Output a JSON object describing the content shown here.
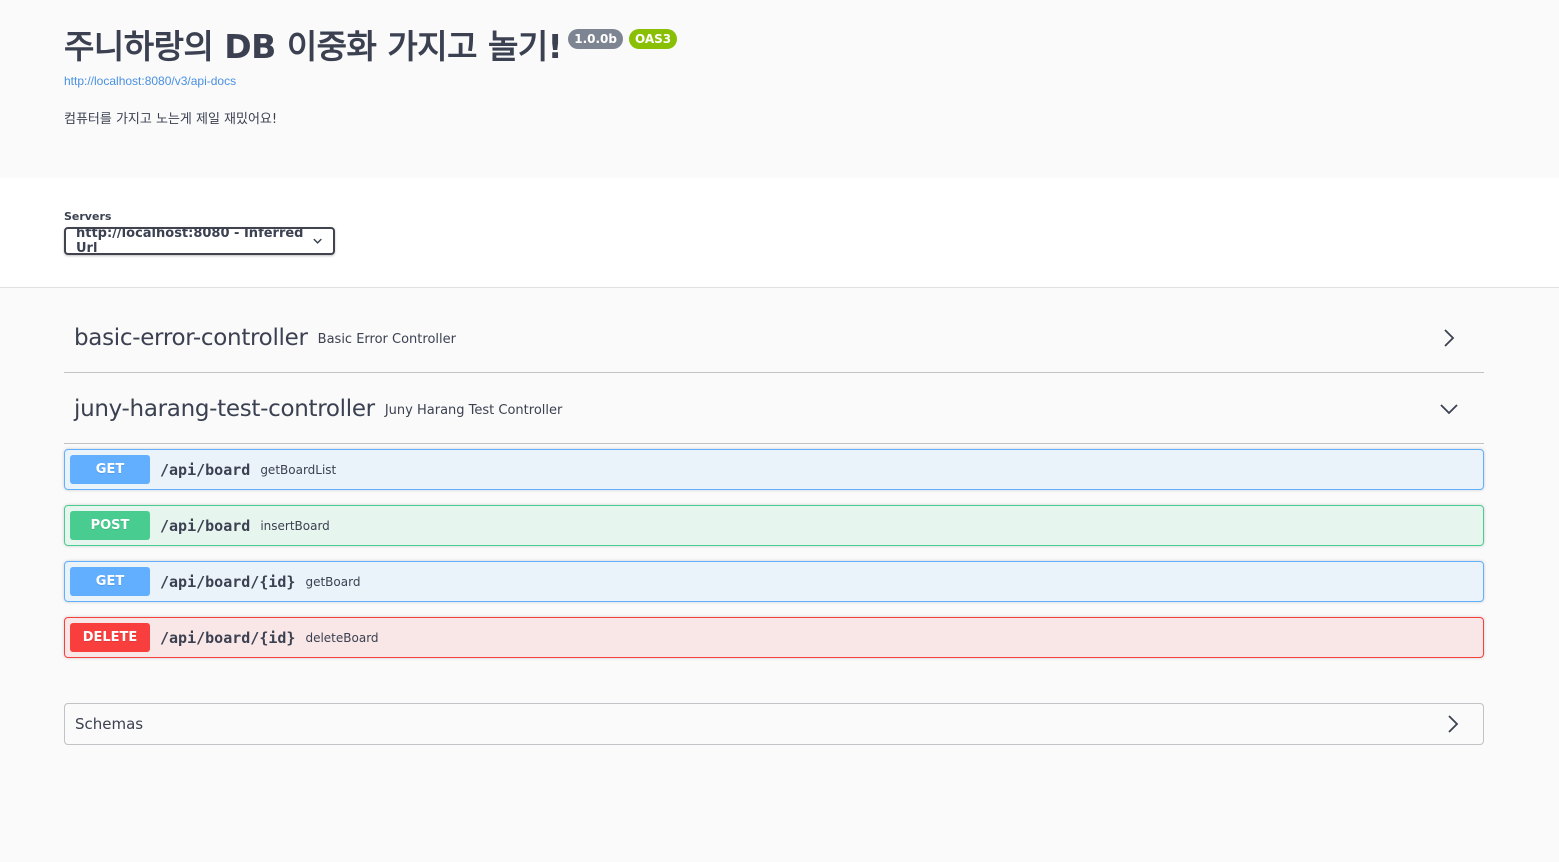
{
  "info": {
    "title": "주니하랑의 DB 이중화 가지고 놀기!",
    "version": "1.0.0b",
    "oas_badge": "OAS3",
    "api_docs_url": "http://localhost:8080/v3/api-docs",
    "description": "컴퓨터를 가지고 노는게 제일 재밌어요!"
  },
  "servers": {
    "label": "Servers",
    "selected": "http://localhost:8080 - Inferred Url"
  },
  "tags": [
    {
      "name": "basic-error-controller",
      "description": "Basic Error Controller",
      "expanded": false
    },
    {
      "name": "juny-harang-test-controller",
      "description": "Juny Harang Test Controller",
      "expanded": true,
      "operations": [
        {
          "method": "GET",
          "path": "/api/board",
          "summary": "getBoardList"
        },
        {
          "method": "POST",
          "path": "/api/board",
          "summary": "insertBoard"
        },
        {
          "method": "GET",
          "path": "/api/board/{id}",
          "summary": "getBoard"
        },
        {
          "method": "DELETE",
          "path": "/api/board/{id}",
          "summary": "deleteBoard"
        }
      ]
    }
  ],
  "models": {
    "title": "Schemas"
  },
  "colors": {
    "get": "#61affe",
    "post": "#49cc90",
    "delete": "#f93e3e",
    "version_badge": "#7d8492",
    "oas_badge": "#89bf04",
    "link": "#4990e2",
    "text": "#3b4151"
  },
  "icons": {
    "tag_collapsed": "chevron-right-icon",
    "tag_expanded": "chevron-down-icon",
    "select": "chevron-down-icon",
    "models": "chevron-right-icon"
  }
}
